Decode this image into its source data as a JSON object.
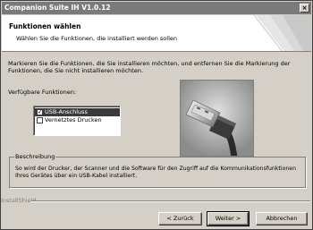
{
  "window": {
    "title": "Companion Suite IH V1.0.12",
    "close_glyph": "×"
  },
  "header": {
    "title": "Funktionen wählen",
    "subtitle": "Wählen Sie die Funktionen, die installiert werden sollen"
  },
  "instructions": "Markieren Sie die Funktionen, die Sie installieren möchten, und entfernen Sie die Markierung der Funktionen, die Sie nicht installieren möchten.",
  "features": {
    "label": "Verfügbare Funktionen:",
    "items": [
      {
        "label": "USB-Anschluss",
        "checked": true,
        "selected": true
      },
      {
        "label": "Vernetztes Drucken",
        "checked": false,
        "selected": false
      }
    ]
  },
  "description": {
    "legend": "Beschreibung",
    "text": "So wird der Drucker, der Scanner und die Software für den Zugriff auf die Kommunikationsfunktionen Ihres Gerätes über ein USB-Kabel installiert."
  },
  "footer": {
    "brand": "InstallShield"
  },
  "buttons": {
    "back": "< Zurück",
    "next": "Weiter >",
    "cancel": "Abbrechen"
  }
}
